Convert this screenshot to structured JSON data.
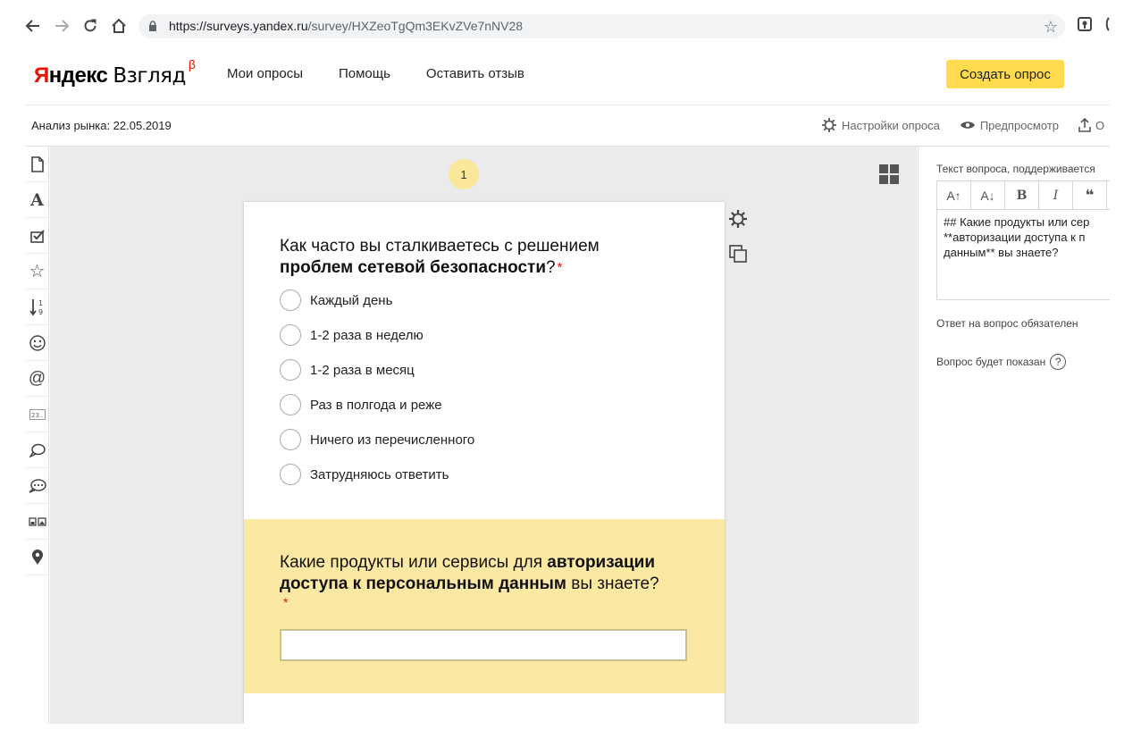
{
  "browser": {
    "url_host": "https://surveys.yandex.ru",
    "url_path": "/survey/HXZeoTgQm3EKvZVe7nNV28"
  },
  "header": {
    "logo_ya": "Я",
    "logo_ndex": "ндекс",
    "logo_product": "Взгляд",
    "logo_beta": "β",
    "nav": [
      "Мои опросы",
      "Помощь",
      "Оставить отзыв"
    ],
    "create_button": "Создать опрос"
  },
  "subheader": {
    "survey_title": "Анализ рынка: 22.05.2019",
    "settings": "Настройки опроса",
    "preview": "Предпросмотр",
    "publish": "О"
  },
  "canvas": {
    "page_number": "1",
    "question1": {
      "title_plain": "Как часто вы сталкиваетесь с решением ",
      "title_bold": "проблем сетевой безопасности",
      "title_end": "?",
      "required_mark": "*",
      "options": [
        "Каждый день",
        "1-2 раза в неделю",
        "1-2 раза в месяц",
        "Раз в полгода и реже",
        "Ничего из перечисленного",
        "Затрудняюсь ответить"
      ]
    },
    "question2": {
      "title_plain": "Какие продукты или сервисы для ",
      "title_bold": "авторизации доступа к персональным данным",
      "title_end": " вы знаете?",
      "required_mark": "*"
    }
  },
  "rightpanel": {
    "text_label": "Текст вопроса, поддерживается",
    "toolbar": [
      "A↑",
      "A↓",
      "B",
      "I",
      "❝"
    ],
    "editor_text": "## Какие продукты или сер\n**авторизации доступа к п\nданным** вы знаете?",
    "required_label": "Ответ на вопрос обязателен",
    "shown_label": "Вопрос будет показан"
  }
}
